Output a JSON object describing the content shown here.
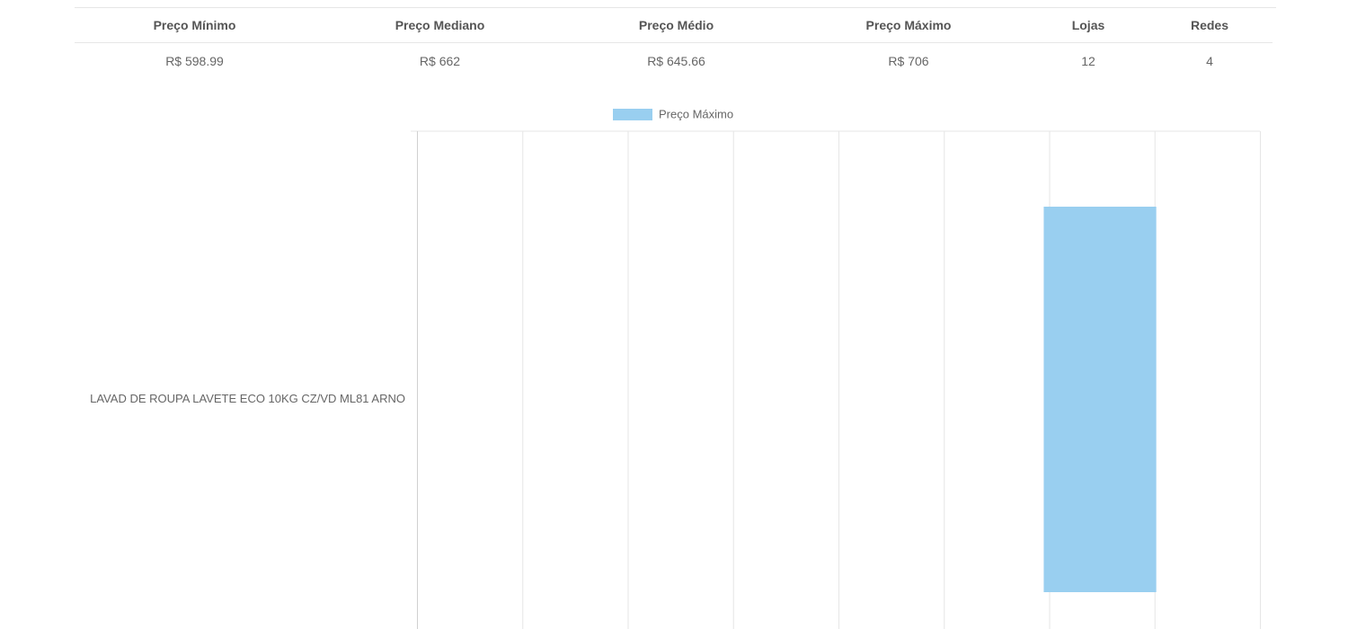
{
  "summary_table": {
    "headers": [
      "Preço Mínimo",
      "Preço Mediano",
      "Preço Médio",
      "Preço Máximo",
      "Lojas",
      "Redes"
    ],
    "values": [
      "R$ 598.99",
      "R$ 662",
      "R$ 645.66",
      "R$ 706",
      "12",
      "4"
    ]
  },
  "chart_data": {
    "type": "bar",
    "orientation": "horizontal",
    "categories": [
      "LAVAD DE ROUPA LAVETE ECO 10KG CZ/VD ML81 ARNO"
    ],
    "series": [
      {
        "name": "Preço Máximo",
        "values": [
          706
        ],
        "color": "#99CFF0"
      }
    ],
    "xlim": [
      0,
      805
    ],
    "grid": true,
    "legend": "top-center"
  }
}
